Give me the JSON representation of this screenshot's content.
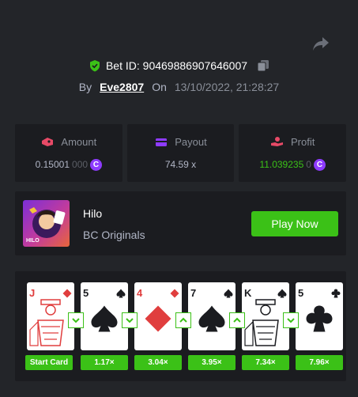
{
  "bet": {
    "id_label": "Bet ID: 90469886907646007",
    "by_label": "By",
    "user": "Eve2807",
    "on_label": "On",
    "date": "13/10/2022, 21:28:27"
  },
  "stats": {
    "amount": {
      "label": "Amount",
      "value_main": "0.15001",
      "value_dim": "000",
      "icon": "wallet-icon",
      "color": "#e84a67"
    },
    "payout": {
      "label": "Payout",
      "value": "74.59 x",
      "icon": "card-icon",
      "color": "#8e3bff"
    },
    "profit": {
      "label": "Profit",
      "value_main": "11.039235",
      "value_dim": "0",
      "icon": "hand-coin-icon",
      "color": "#e84a67"
    }
  },
  "game": {
    "thumb_label": "HILO",
    "title": "Hilo",
    "subtitle": "BC Originals",
    "play_label": "Play Now"
  },
  "history": {
    "cards": [
      {
        "rank": "J",
        "suit": "diamond",
        "face": true
      },
      {
        "rank": "5",
        "suit": "spade",
        "face": false
      },
      {
        "rank": "4",
        "suit": "diamond",
        "face": false
      },
      {
        "rank": "7",
        "suit": "spade",
        "face": false
      },
      {
        "rank": "K",
        "suit": "spade",
        "face": true
      },
      {
        "rank": "5",
        "suit": "club",
        "face": false
      }
    ],
    "arrows": [
      "down",
      "down",
      "up",
      "up",
      "down"
    ],
    "multipliers": [
      "Start Card",
      "1.17×",
      "3.04×",
      "3.95×",
      "7.34×",
      "7.96×"
    ]
  },
  "colors": {
    "accent_green": "#3bc117",
    "coin_purple": "#8e3bff",
    "background": "#232529",
    "panel": "#1b1c20"
  }
}
